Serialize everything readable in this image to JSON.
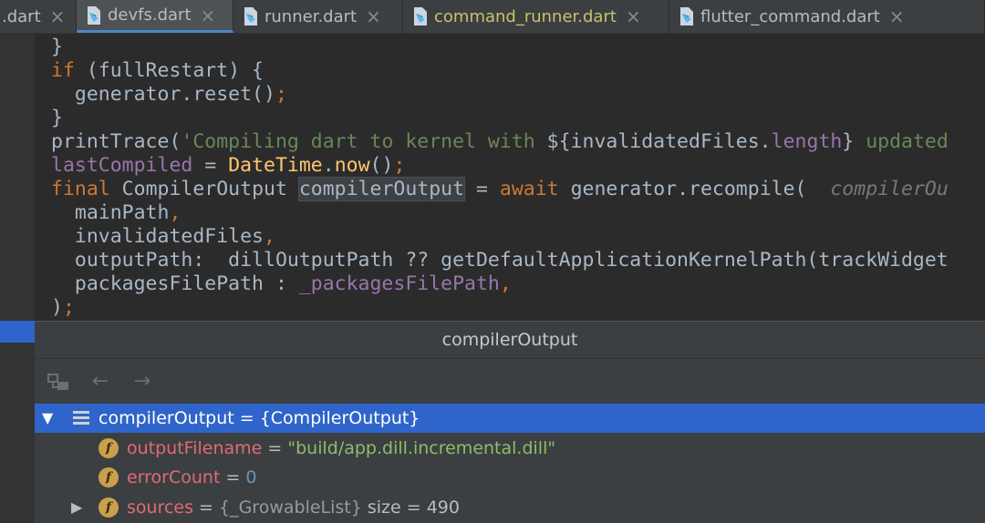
{
  "tabs": [
    {
      "label": ".dart",
      "close": "×"
    },
    {
      "label": "devfs.dart",
      "close": "×",
      "active": true
    },
    {
      "label": "runner.dart",
      "close": "×"
    },
    {
      "label": "command_runner.dart",
      "close": "×"
    },
    {
      "label": "flutter_command.dart",
      "close": "×"
    }
  ],
  "code": {
    "l0": "}",
    "l1_kw": "if",
    "l1_rest": " (fullRestart) {",
    "l2_a": "  generator.reset()",
    "l2_semi": ";",
    "l3": "}",
    "l4_a": "printTrace(",
    "l4_str": "'Compiling dart to kernel with ",
    "l4_b": "${invalidatedFiles.",
    "l4_fld": "length",
    "l4_c": "} ",
    "l4_str2": "updated",
    "l5_fld": "lastCompiled",
    "l5_a": " = ",
    "l5_cls": "DateTime",
    "l5_b": ".",
    "l5_now": "now",
    "l5_c": "()",
    "l5_semi": ";",
    "l6_kw": "final",
    "l6_a": " CompilerOutput ",
    "l6_sel": "compilerOutput",
    "l6_b": " = ",
    "l6_kw2": "await",
    "l6_c": " generator.recompile(  ",
    "l6_hint": "compilerOu",
    "l7_a": "  mainPath",
    "l7_comma": ",",
    "l8_a": "  invalidatedFiles",
    "l8_comma": ",",
    "l9_a": "  outputPath:  dillOutputPath ?? getDefaultApplicationKernelPath(trackWidget",
    "l10_a": "  packagesFilePath : ",
    "l10_fld": "_packagesFilePath",
    "l10_comma": ",",
    "l11_a": ")",
    "l11_semi": ";"
  },
  "popup": {
    "title": "compilerOutput",
    "rows": [
      {
        "name": "compilerOutput",
        "eq": " = ",
        "value": "{CompilerOutput}"
      },
      {
        "name": "outputFilename",
        "eq": " = ",
        "value": "\"build/app.dill.incremental.dill\""
      },
      {
        "name": "errorCount",
        "eq": " = ",
        "value": "0"
      },
      {
        "name": "sources",
        "eq": " = ",
        "type": "{_GrowableList}",
        "extra": " size = 490"
      }
    ],
    "badge": "f"
  }
}
